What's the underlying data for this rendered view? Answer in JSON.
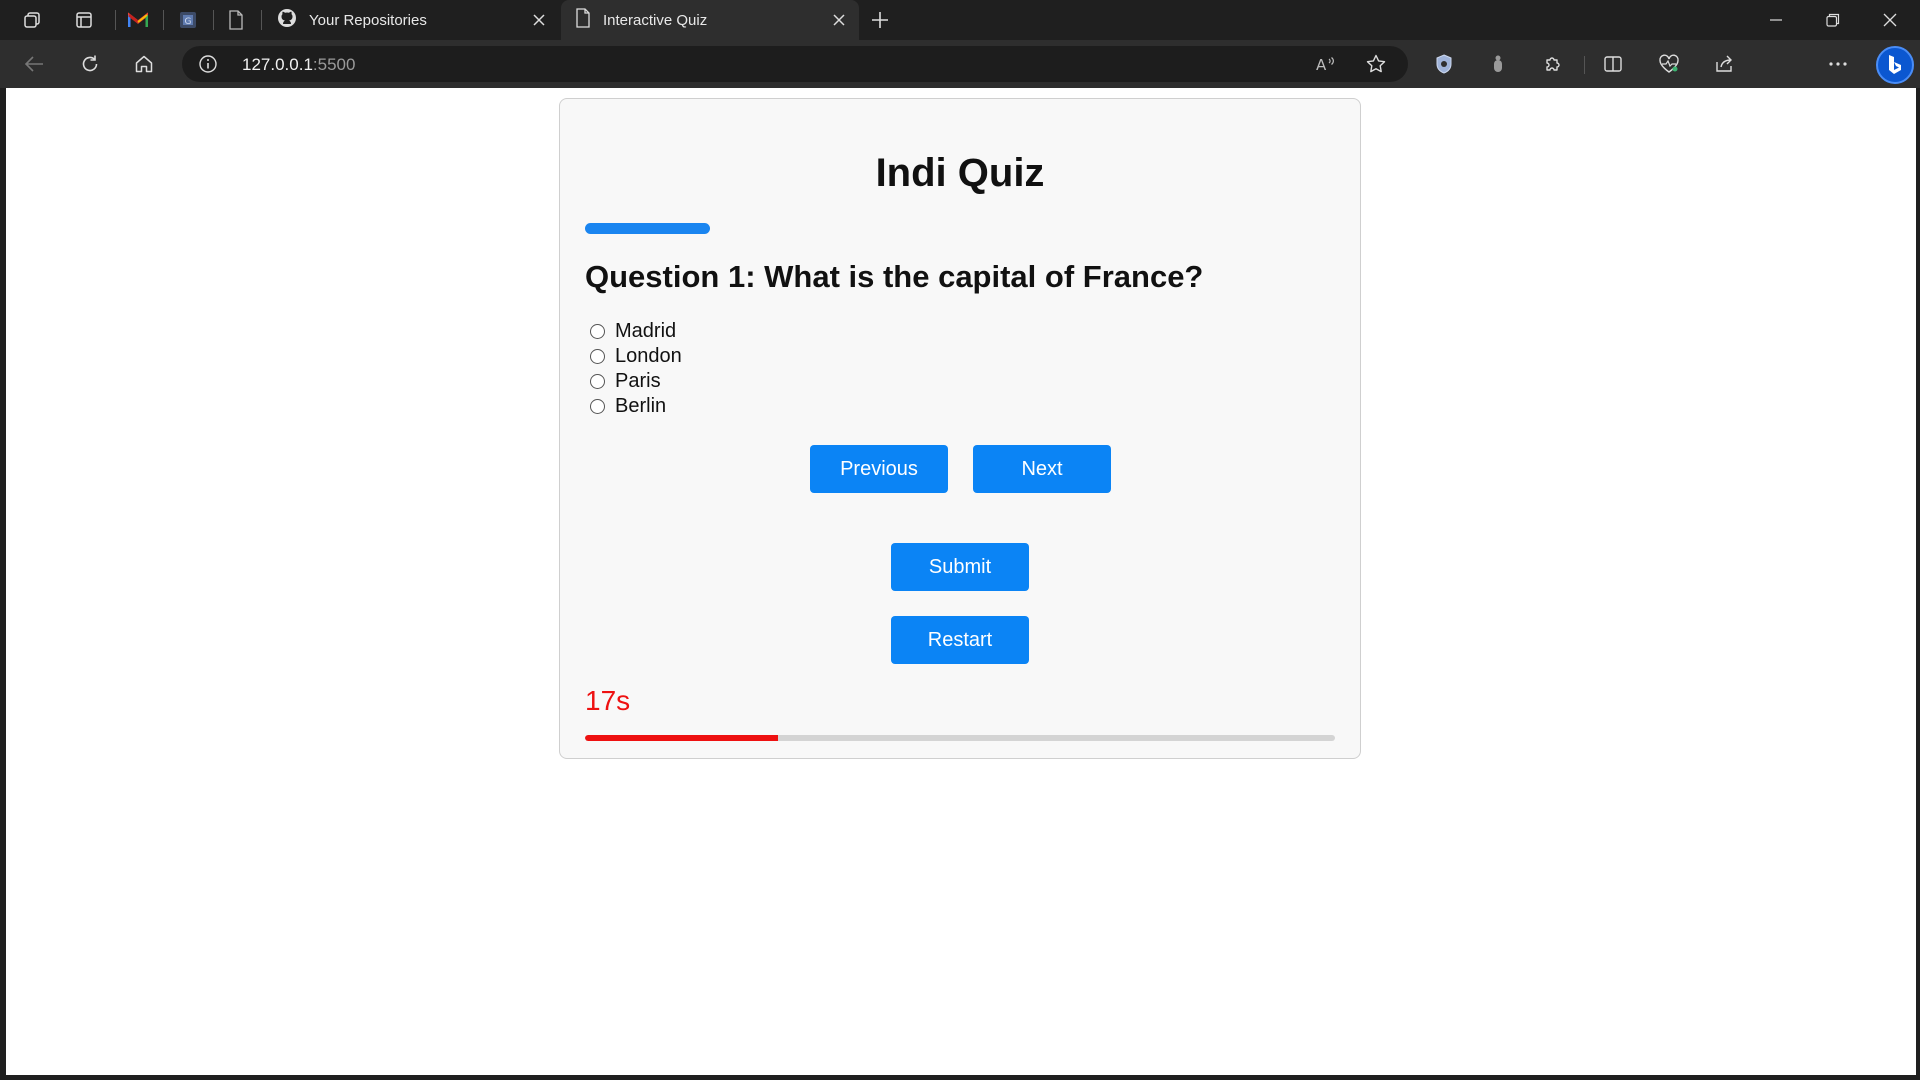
{
  "browser": {
    "tabs": [
      {
        "title": "Your Repositories",
        "icon": "github-icon",
        "active": false
      },
      {
        "title": "Interactive Quiz",
        "icon": "page-icon",
        "active": true
      }
    ],
    "pinned_icons": [
      "gmail-icon",
      "google-docs-icon",
      "blank-page-icon"
    ],
    "address": {
      "host": "127.0.0.1",
      "port": ":5500"
    }
  },
  "quiz": {
    "title": "Indi Quiz",
    "question": "Question 1: What is the capital of France?",
    "options": [
      "Madrid",
      "London",
      "Paris",
      "Berlin"
    ],
    "buttons": {
      "previous": "Previous",
      "next": "Next",
      "submit": "Submit",
      "restart": "Restart"
    },
    "timer": {
      "label": "17s",
      "progress_fraction": 0.257
    },
    "colors": {
      "accent": "#0b84f5",
      "timer": "#ee1111"
    }
  }
}
